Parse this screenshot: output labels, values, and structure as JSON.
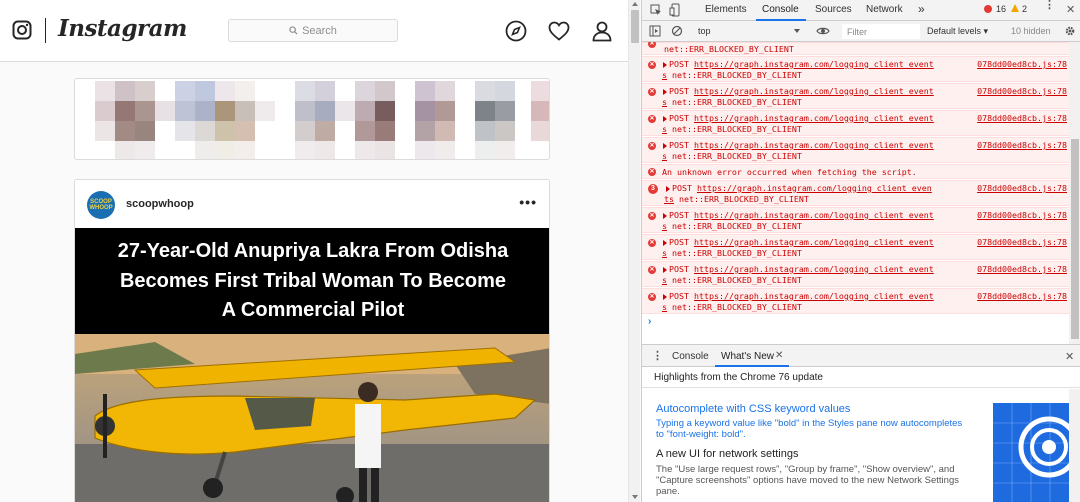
{
  "instagram": {
    "wordmark": "Instagram",
    "search_placeholder": "Search",
    "post": {
      "username": "scoopwhoop",
      "avatar_text": "SCOOP WHOOP",
      "more_glyph": "•••",
      "headline_lines": [
        "27-Year-Old Anupriya Lakra From Odisha",
        "Becomes First Tribal Woman To Become",
        "A Commercial Pilot"
      ]
    }
  },
  "devtools": {
    "tabs": [
      "Elements",
      "Console",
      "Sources",
      "Network"
    ],
    "active_tab": "Console",
    "more_tabs_glyph": "»",
    "error_count": "16",
    "warning_count": "2",
    "context": "top",
    "filter_placeholder": "Filter",
    "levels": "Default levels ▾",
    "hidden_count": "10 hidden",
    "messages": [
      {
        "type": "cont",
        "line1": "net::ERR_BLOCKED_BY_CLIENT"
      },
      {
        "type": "post",
        "method": "POST",
        "url": "https://graph.instagram.com/logging_client_event",
        "src": "078dd00ed8cb.js:78",
        "src2": "s",
        "error": "net::ERR_BLOCKED_BY_CLIENT"
      },
      {
        "type": "post",
        "method": "POST",
        "url": "https://graph.instagram.com/logging_client_event",
        "src": "078dd00ed8cb.js:78",
        "src2": "s",
        "error": "net::ERR_BLOCKED_BY_CLIENT"
      },
      {
        "type": "post",
        "method": "POST",
        "url": "https://graph.instagram.com/logging_client_event",
        "src": "078dd00ed8cb.js:78",
        "src2": "s",
        "error": "net::ERR_BLOCKED_BY_CLIENT"
      },
      {
        "type": "post",
        "method": "POST",
        "url": "https://graph.instagram.com/logging_client_event",
        "src": "078dd00ed8cb.js:78",
        "src2": "s",
        "error": "net::ERR_BLOCKED_BY_CLIENT"
      },
      {
        "type": "plain",
        "text": "An unknown error occurred when fetching the script."
      },
      {
        "type": "grouped",
        "count": "3",
        "method": "POST",
        "url": "https://graph.instagram.com/logging_client_even",
        "url_cont": "ts",
        "src": "078dd00ed8cb.js:78",
        "src2": "s",
        "error": "net::ERR_BLOCKED_BY_CLIENT"
      },
      {
        "type": "post",
        "method": "POST",
        "url": "https://graph.instagram.com/logging_client_event",
        "src": "078dd00ed8cb.js:78",
        "src2": "s",
        "error": "net::ERR_BLOCKED_BY_CLIENT"
      },
      {
        "type": "post",
        "method": "POST",
        "url": "https://graph.instagram.com/logging_client_event",
        "src": "078dd00ed8cb.js:78",
        "src2": "s",
        "error": "net::ERR_BLOCKED_BY_CLIENT"
      },
      {
        "type": "post",
        "method": "POST",
        "url": "https://graph.instagram.com/logging_client_event",
        "src": "078dd00ed8cb.js:78",
        "src2": "s",
        "error": "net::ERR_BLOCKED_BY_CLIENT"
      },
      {
        "type": "post",
        "method": "POST",
        "url": "https://graph.instagram.com/logging_client_event",
        "src": "078dd00ed8cb.js:78",
        "src2": "s",
        "error": "net::ERR_BLOCKED_BY_CLIENT"
      }
    ],
    "prompt_glyph": "›",
    "drawer_tabs": [
      "Console",
      "What's New"
    ],
    "drawer_active": "What's New",
    "drawer_title": "Highlights from the Chrome 76 update",
    "whats_new": [
      {
        "heading": "Autocomplete with CSS keyword values",
        "body": "Typing a keyword value like \"bold\" in the Styles pane now autocompletes to \"font-weight: bold\".",
        "accent": true
      },
      {
        "heading": "A new UI for network settings",
        "body": "The \"Use large request rows\", \"Group by frame\", \"Show overview\", and \"Capture screenshots\" options have moved to the new Network Settings pane.",
        "accent": false
      }
    ],
    "colors": {
      "error": "#cc0000",
      "error_bg": "#fff0f0",
      "accent": "#1a73e8",
      "warning": "#f2a600"
    }
  }
}
